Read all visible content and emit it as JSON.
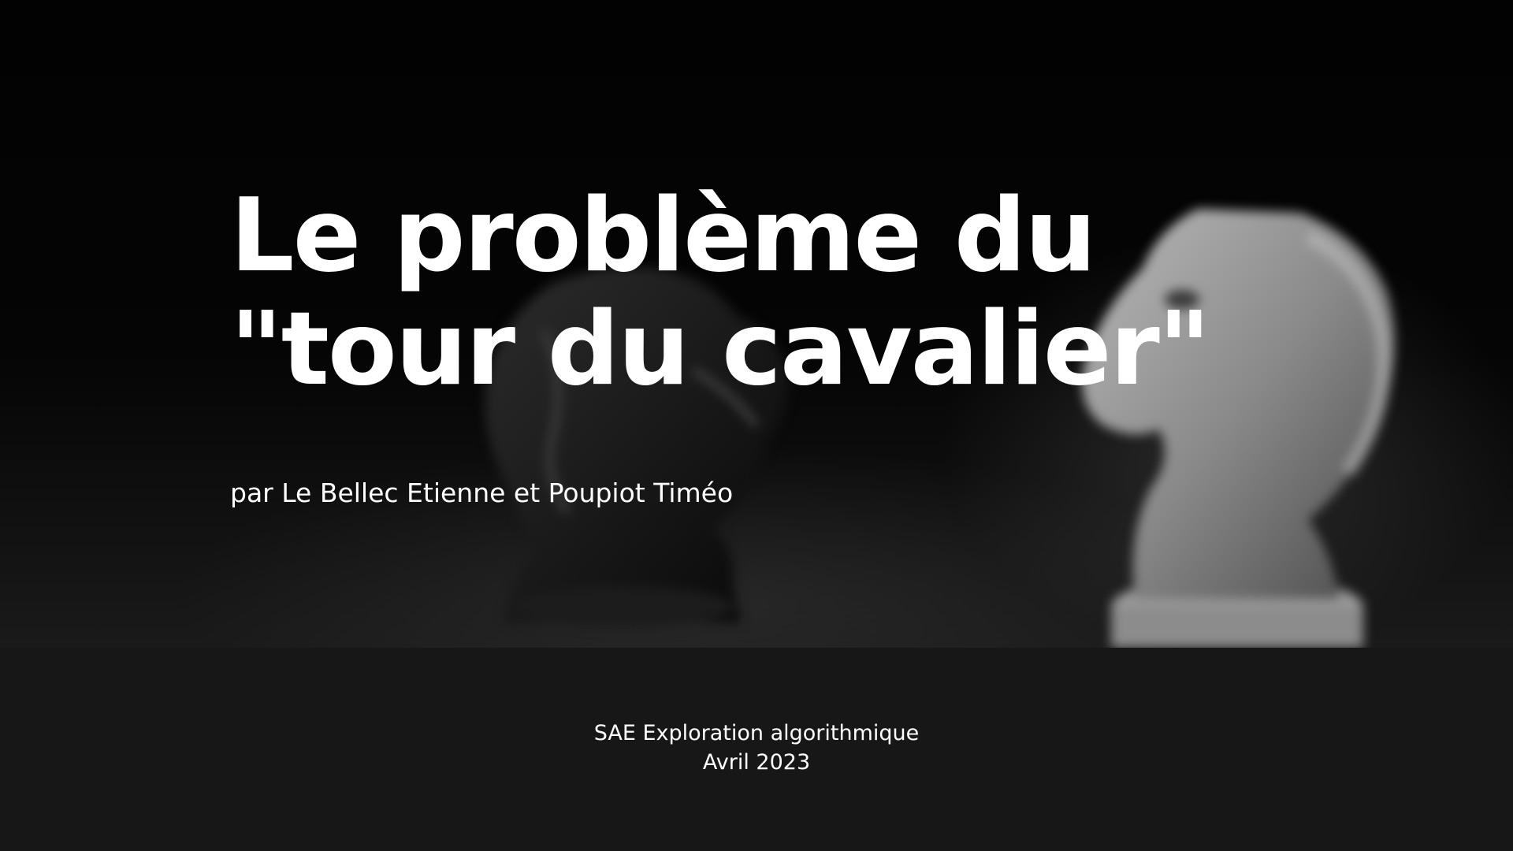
{
  "slide": {
    "title_line_1": "Le problème du",
    "title_line_2": "\"tour du cavalier\"",
    "authors": "par Le Bellec Etienne et Poupiot Timéo",
    "footer_line_1": "SAE Exploration algorithmique",
    "footer_line_2": "Avril 2023"
  },
  "background": {
    "image": "two-chess-knights-icon",
    "colors": {
      "hero": "#000000",
      "footer": "#171717",
      "text": "#ffffff"
    }
  }
}
